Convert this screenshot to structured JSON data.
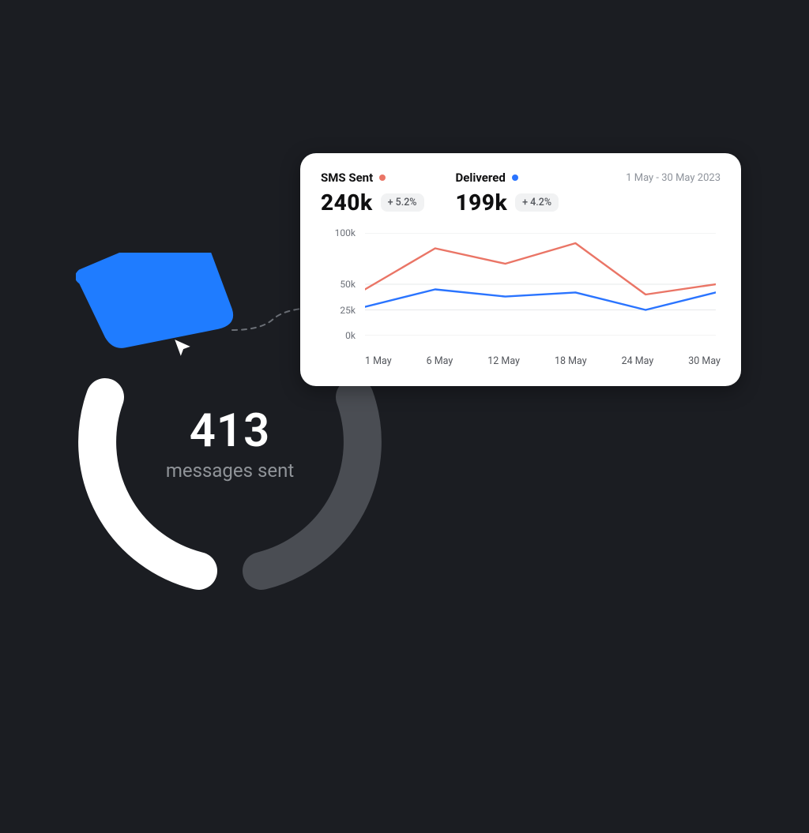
{
  "donut": {
    "value": "413",
    "label": "messages sent"
  },
  "card": {
    "date_range": "1 May - 30 May 2023",
    "metrics": [
      {
        "title": "SMS Sent",
        "value": "240k",
        "delta": "+ 5.2%",
        "color": "#ea7566"
      },
      {
        "title": "Delivered",
        "value": "199k",
        "delta": "+ 4.2%",
        "color": "#2a74ff"
      }
    ]
  },
  "chart_data": {
    "type": "line",
    "title": "",
    "xlabel": "",
    "ylabel": "",
    "ylim": [
      0,
      100
    ],
    "y_ticks": [
      "100k",
      "50k",
      "25k",
      "0k"
    ],
    "categories": [
      "1 May",
      "6 May",
      "12 May",
      "18 May",
      "24 May",
      "30 May"
    ],
    "series": [
      {
        "name": "SMS Sent",
        "color": "#ea7566",
        "values": [
          45,
          85,
          70,
          90,
          40,
          50
        ]
      },
      {
        "name": "Delivered",
        "color": "#2a74ff",
        "values": [
          28,
          45,
          38,
          42,
          25,
          42
        ]
      }
    ]
  }
}
